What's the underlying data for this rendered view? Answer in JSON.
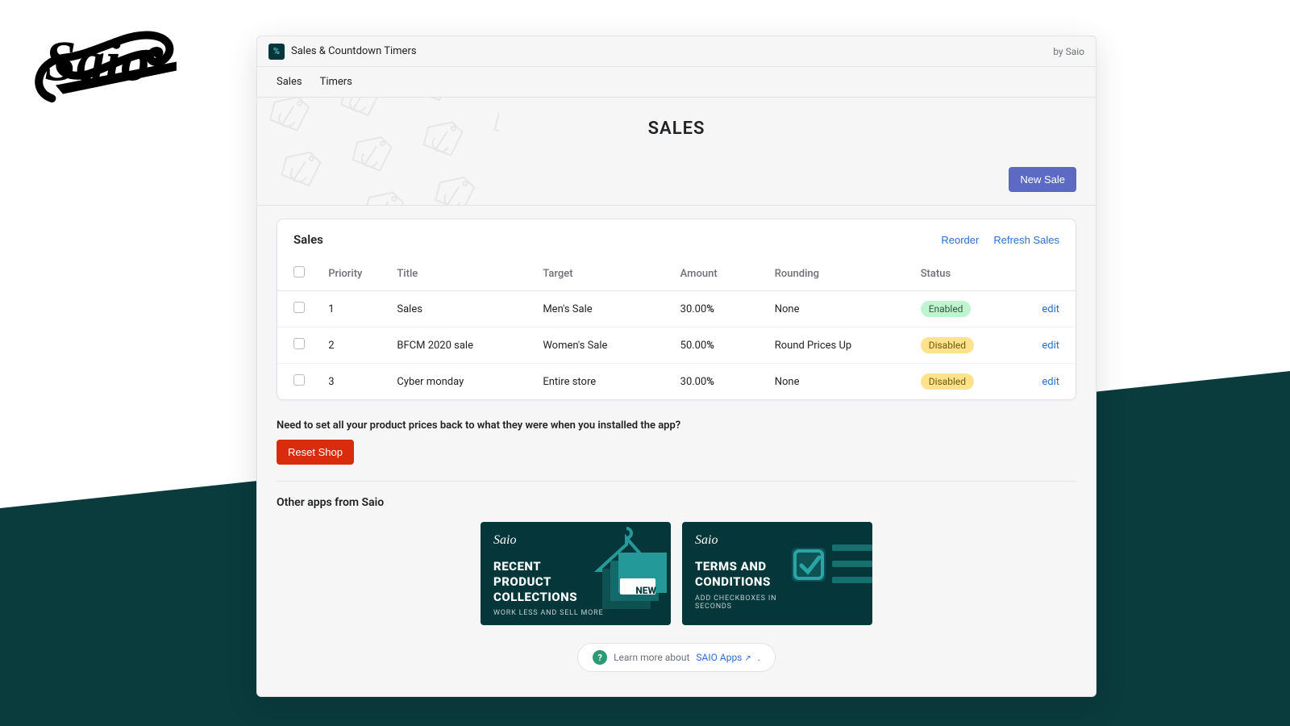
{
  "brand": {
    "name": "Saio"
  },
  "header": {
    "app_title": "Sales & Countdown Timers",
    "by_label": "by Saio"
  },
  "nav": {
    "items": [
      {
        "label": "Sales"
      },
      {
        "label": "Timers"
      }
    ]
  },
  "hero": {
    "title": "SALES",
    "new_sale_label": "New Sale"
  },
  "sales_card": {
    "title": "Sales",
    "reorder_label": "Reorder",
    "refresh_label": "Refresh Sales",
    "columns": {
      "priority": "Priority",
      "title": "Title",
      "target": "Target",
      "amount": "Amount",
      "rounding": "Rounding",
      "status": "Status"
    },
    "rows": [
      {
        "priority": "1",
        "title": "Sales",
        "target": "Men's Sale",
        "amount": "30.00",
        "amount_suffix": "%",
        "rounding": "None",
        "status": "Enabled",
        "status_kind": "enabled",
        "edit": "edit"
      },
      {
        "priority": "2",
        "title": "BFCM 2020 sale",
        "target": "Women's Sale",
        "amount": "50.00",
        "amount_suffix": "%",
        "rounding": "Round Prices Up",
        "status": "Disabled",
        "status_kind": "disabled",
        "edit": "edit"
      },
      {
        "priority": "3",
        "title": "Cyber monday",
        "target": "Entire store",
        "amount": "30.00",
        "amount_suffix": "%",
        "rounding": "None",
        "status": "Disabled",
        "status_kind": "disabled",
        "edit": "edit"
      }
    ]
  },
  "reset": {
    "prompt": "Need to set all your product prices back to what they were when you installed the app?",
    "button_label": "Reset Shop"
  },
  "other_apps": {
    "heading": "Other apps from Saio",
    "promos": [
      {
        "brand": "Saio",
        "title": "RECENT PRODUCT COLLECTIONS",
        "subtitle": "WORK LESS AND SELL MORE",
        "tag": "NEW"
      },
      {
        "brand": "Saio",
        "title": "TERMS AND CONDITIONS",
        "subtitle": "ADD CHECKBOXES IN SECONDS",
        "tag": ""
      }
    ]
  },
  "learn_more": {
    "prefix": "Learn more about ",
    "link_label": "SAIO Apps",
    "suffix": "."
  }
}
